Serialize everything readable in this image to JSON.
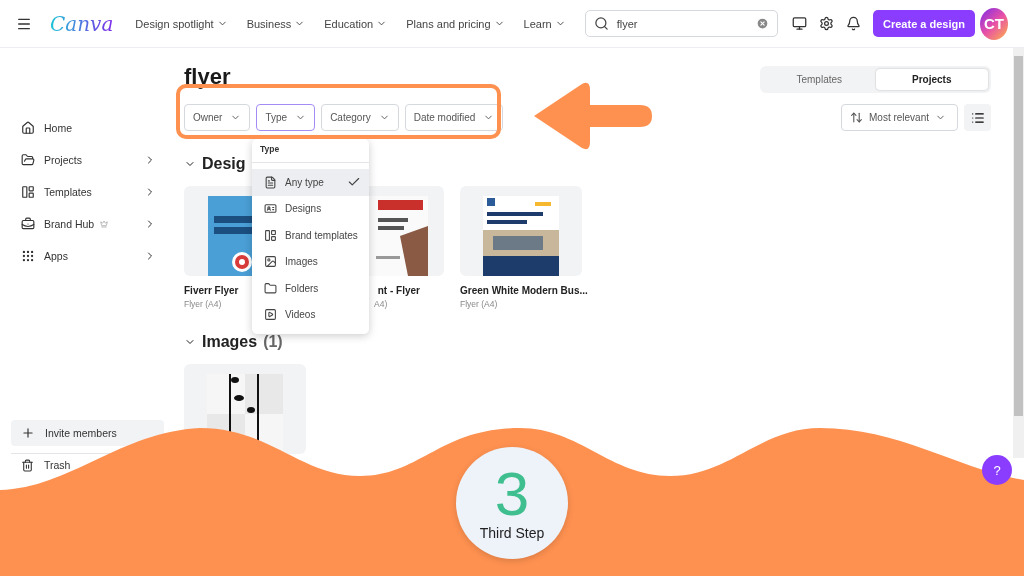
{
  "topbar": {
    "logo": "Canva",
    "nav": [
      "Design spotlight",
      "Business",
      "Education",
      "Plans and pricing",
      "Learn"
    ],
    "search": {
      "value": "flyer"
    },
    "create_button": "Create a design",
    "avatar": "CT"
  },
  "sidebar": {
    "items": [
      {
        "label": "Home",
        "submenu": false,
        "premium": false
      },
      {
        "label": "Projects",
        "submenu": true,
        "premium": false
      },
      {
        "label": "Templates",
        "submenu": true,
        "premium": false
      },
      {
        "label": "Brand Hub",
        "submenu": true,
        "premium": true
      },
      {
        "label": "Apps",
        "submenu": true,
        "premium": false
      }
    ],
    "invite": "Invite members",
    "trash": "Trash"
  },
  "main": {
    "title": "flyer",
    "view_tabs": [
      {
        "label": "Templates",
        "selected": false
      },
      {
        "label": "Projects",
        "selected": true
      }
    ],
    "filters": [
      {
        "label": "Owner",
        "selected": false
      },
      {
        "label": "Type",
        "selected": true
      },
      {
        "label": "Category",
        "selected": false
      },
      {
        "label": "Date modified",
        "selected": false
      }
    ],
    "sort": "Most relevant",
    "type_menu": {
      "title": "Type",
      "options": [
        {
          "label": "Any type",
          "selected": true
        },
        {
          "label": "Designs",
          "selected": false
        },
        {
          "label": "Brand templates",
          "selected": false
        },
        {
          "label": "Images",
          "selected": false
        },
        {
          "label": "Folders",
          "selected": false
        },
        {
          "label": "Videos",
          "selected": false
        }
      ]
    },
    "designs_section": {
      "title": "Desig",
      "expanded": true
    },
    "designs": [
      {
        "name": "Fiverr Flyer",
        "subtitle": "Flyer (A4)",
        "covered": false,
        "kind": "blue"
      },
      {
        "name": "nt - Flyer",
        "subtitle": "A4)",
        "covered": true,
        "kind": "flyer"
      },
      {
        "name": "Green White Modern Bus...",
        "subtitle": "Flyer (A4)",
        "covered": false,
        "kind": "building"
      }
    ],
    "images_section": {
      "title": "Images",
      "count": "(1)",
      "expanded": true
    }
  },
  "overlay": {
    "step_number": "3",
    "step_label": "Third Step"
  },
  "help": "?"
}
